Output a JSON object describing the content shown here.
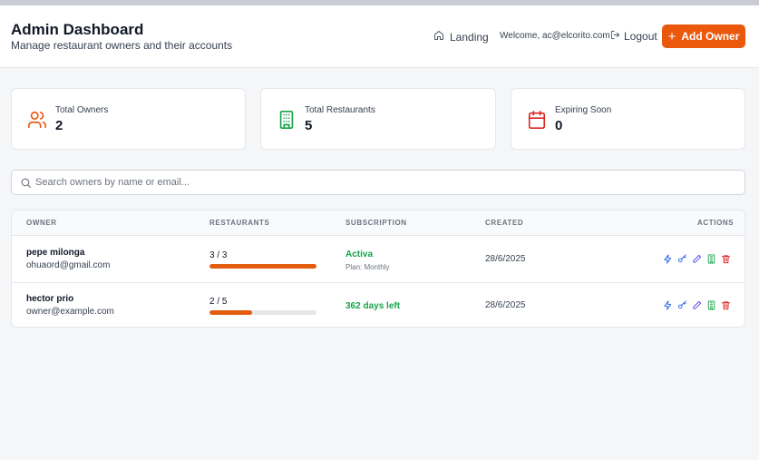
{
  "header": {
    "title": "Admin Dashboard",
    "subtitle": "Manage restaurant owners and their accounts",
    "landing_label": "Landing",
    "welcome_text": "Welcome, ac@elcorito.com",
    "logout_label": "Logout",
    "add_owner_label": "Add Owner",
    "accent_color": "#ea580c"
  },
  "stats": [
    {
      "label": "Total Owners",
      "value": "2",
      "icon": "users-icon",
      "color": "#ea580c"
    },
    {
      "label": "Total Restaurants",
      "value": "5",
      "icon": "building-icon",
      "color": "#16a34a"
    },
    {
      "label": "Expiring Soon",
      "value": "0",
      "icon": "calendar-icon",
      "color": "#dc2626"
    }
  ],
  "search": {
    "placeholder": "Search owners by name or email...",
    "value": ""
  },
  "table": {
    "columns": [
      "OWNER",
      "RESTAURANTS",
      "SUBSCRIPTION",
      "CREATED",
      "ACTIONS"
    ],
    "rows": [
      {
        "name": "pepe milonga",
        "email": "ohuaord@gmail.com",
        "restaurants": "3 / 3",
        "restaurants_fraction": 1.0,
        "subscription_status": "Activa",
        "subscription_plan": "Plan: Monthly",
        "created": "28/6/2025"
      },
      {
        "name": "hector prio",
        "email": "owner@example.com",
        "restaurants": "2 / 5",
        "restaurants_fraction": 0.4,
        "subscription_status": "362 days left",
        "subscription_plan": "",
        "created": "28/6/2025"
      }
    ],
    "action_icons": [
      "lightning-icon",
      "key-icon",
      "edit-pencil-icon",
      "building-icon",
      "trash-icon"
    ],
    "status_color": "#16a34a",
    "bar_color": "#e35d0e"
  }
}
